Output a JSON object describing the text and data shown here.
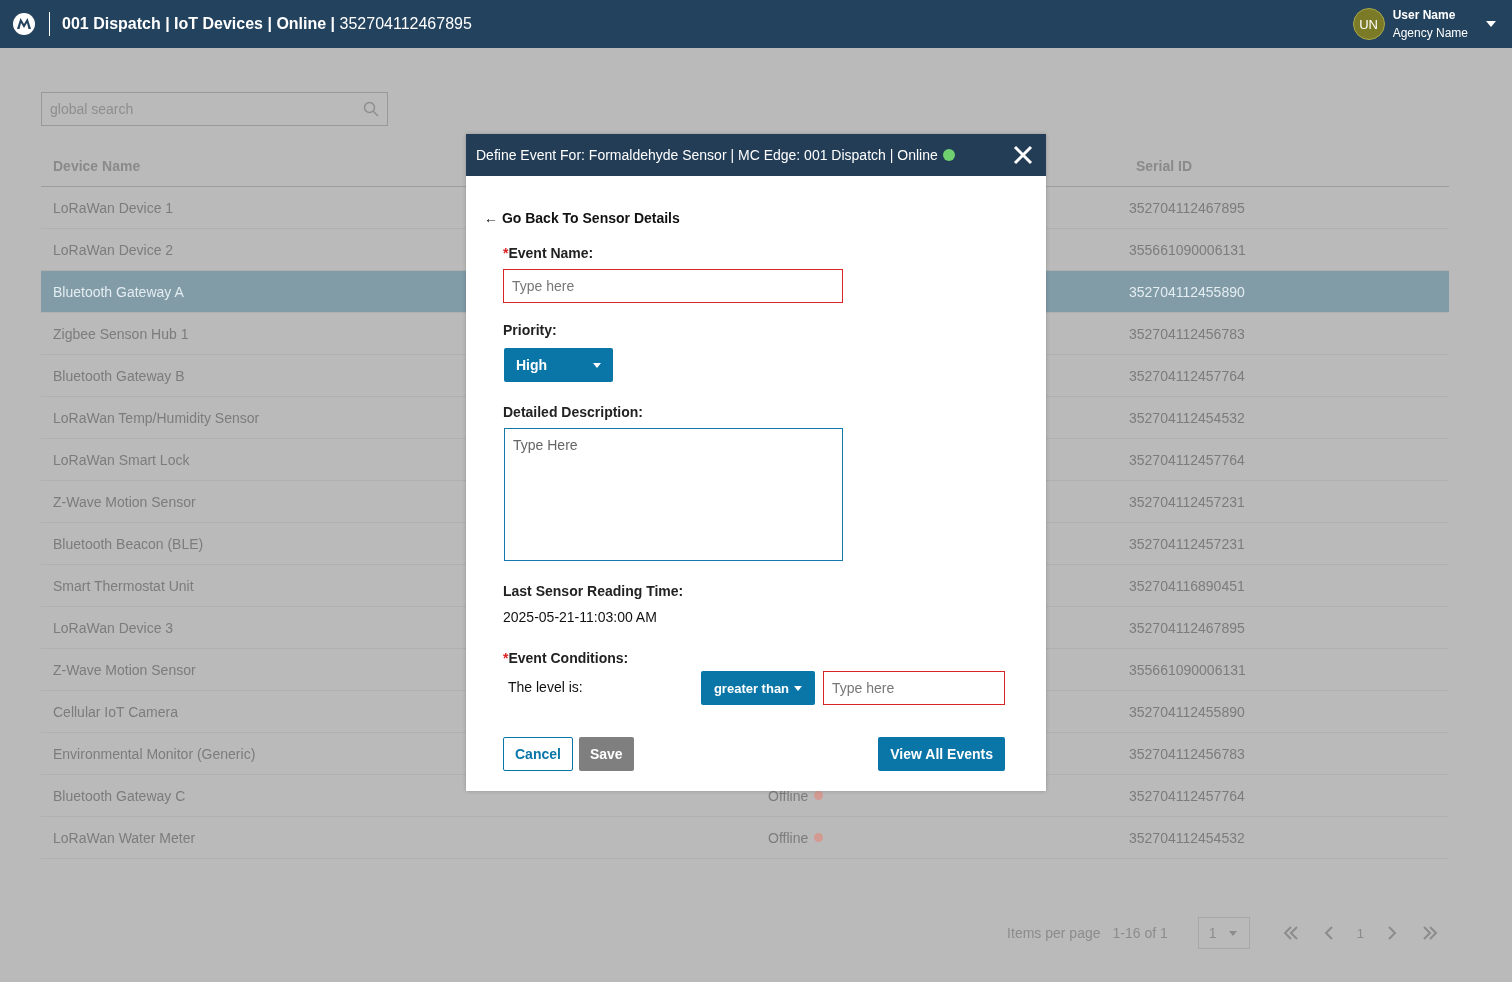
{
  "header": {
    "title_bold": "001 Dispatch | IoT Devices | Online |",
    "title_rest": "352704112467895",
    "avatar": "UN",
    "user_name": "User Name",
    "agency_name": "Agency Name"
  },
  "search": {
    "placeholder": "global search"
  },
  "table": {
    "columns": [
      "Device Name",
      "Serial ID"
    ],
    "rows": [
      {
        "name": "LoRaWan Device 1",
        "serial": "352704112467895",
        "selected": false
      },
      {
        "name": "LoRaWan Device 2",
        "serial": "355661090006131",
        "selected": false
      },
      {
        "name": "Bluetooth Gateway A",
        "serial": "352704112455890",
        "selected": true
      },
      {
        "name": "Zigbee Senson Hub 1",
        "serial": "352704112456783",
        "selected": false
      },
      {
        "name": "Bluetooth Gateway B",
        "serial": "352704112457764",
        "selected": false
      },
      {
        "name": "LoRaWan Temp/Humidity Sensor",
        "serial": "352704112454532",
        "selected": false
      },
      {
        "name": "LoRaWan Smart Lock",
        "serial": "352704112457764",
        "selected": false
      },
      {
        "name": "Z-Wave Motion Sensor",
        "serial": "352704112457231",
        "selected": false
      },
      {
        "name": "Bluetooth Beacon (BLE)",
        "serial": "352704112457231",
        "selected": false
      },
      {
        "name": "Smart Thermostat Unit",
        "serial": "352704116890451",
        "selected": false
      },
      {
        "name": "LoRaWan Device 3",
        "serial": "352704112467895",
        "selected": false
      },
      {
        "name": "Z-Wave Motion Sensor",
        "serial": "355661090006131",
        "selected": false
      },
      {
        "name": "Cellular IoT Camera",
        "serial": "352704112455890",
        "selected": false
      },
      {
        "name": "Environmental Monitor (Generic)",
        "serial": "352704112456783",
        "selected": false
      },
      {
        "name": "Bluetooth Gateway C",
        "status": "Offline",
        "online": false,
        "serial": "352704112457764",
        "selected": false
      },
      {
        "name": "LoRaWan Water Meter",
        "status": "Offline",
        "online": false,
        "serial": "352704112454532",
        "selected": false
      }
    ]
  },
  "pagination": {
    "items_per_page_label": "Items per page",
    "range": "1-16 of 1",
    "per_page_value": "1",
    "page": "1"
  },
  "dialog": {
    "title": "Define Event For: Formaldehyde Sensor | MC Edge: 001 Dispatch | Online",
    "online": true,
    "back_link": "← Go Back To Sensor Details",
    "event_name": {
      "required_mark": "*",
      "label": "Event Name:",
      "placeholder": "Type here"
    },
    "priority": {
      "label": "Priority:",
      "value": "High"
    },
    "description": {
      "label": "Detailed Description:",
      "placeholder": "Type Here"
    },
    "last_reading": {
      "label": "Last Sensor Reading Time:",
      "value": "2025-05-21-11:03:00 AM"
    },
    "conditions": {
      "required_mark": "*",
      "label": "Event Conditions:",
      "prefix": "The level is:",
      "operator": "greater than",
      "placeholder": "Type here"
    },
    "buttons": {
      "cancel": "Cancel",
      "save": "Save",
      "view_all": "View All Events"
    }
  }
}
